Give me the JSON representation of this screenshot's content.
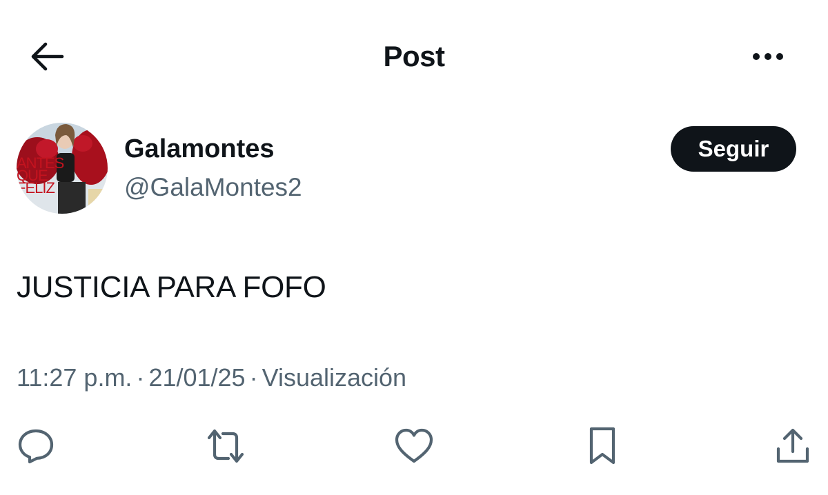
{
  "header": {
    "title": "Post",
    "back_icon": "arrow-left-icon",
    "more_icon": "more-horizontal-icon"
  },
  "author": {
    "display_name": "Galamontes",
    "handle": "@GalaMontes2",
    "avatar_text_line1": "ANTES",
    "avatar_text_line2": "QUE",
    "avatar_text_line3": "FELIZ",
    "follow_label": "Seguir"
  },
  "post": {
    "text": "JUSTICIA PARA FOFO",
    "time": "11:27 p.m.",
    "date": "21/01/25",
    "views_label": "Visualización",
    "separator": "·"
  },
  "actions": {
    "reply_icon": "reply-icon",
    "repost_icon": "repost-icon",
    "like_icon": "heart-icon",
    "bookmark_icon": "bookmark-icon",
    "share_icon": "share-icon"
  },
  "colors": {
    "text_primary": "#0f1419",
    "text_secondary": "#536471",
    "icon_gray": "#536471",
    "button_bg": "#0f1419",
    "button_text": "#ffffff",
    "avatar_red": "#b3121f"
  }
}
